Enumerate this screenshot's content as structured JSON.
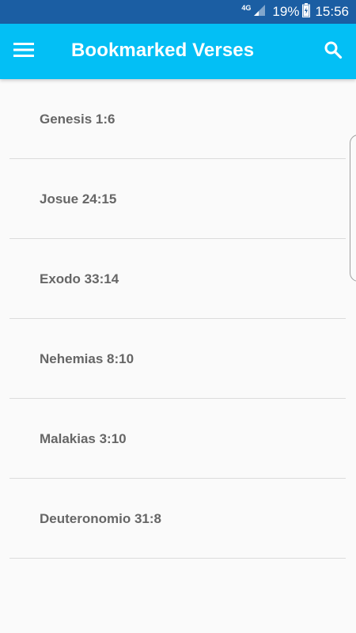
{
  "status_bar": {
    "network": "4G",
    "battery_percent": "19%",
    "time": "15:56"
  },
  "app_bar": {
    "title": "Bookmarked Verses",
    "menu_icon": "hamburger-menu-icon",
    "search_icon": "search-icon",
    "background_color": "#03bff5"
  },
  "bookmarks": [
    {
      "label": "Genesis 1:6"
    },
    {
      "label": "Josue 24:15"
    },
    {
      "label": "Exodo 33:14"
    },
    {
      "label": "Nehemias 8:10"
    },
    {
      "label": "Malakias 3:10"
    },
    {
      "label": "Deuteronomio 31:8"
    }
  ]
}
